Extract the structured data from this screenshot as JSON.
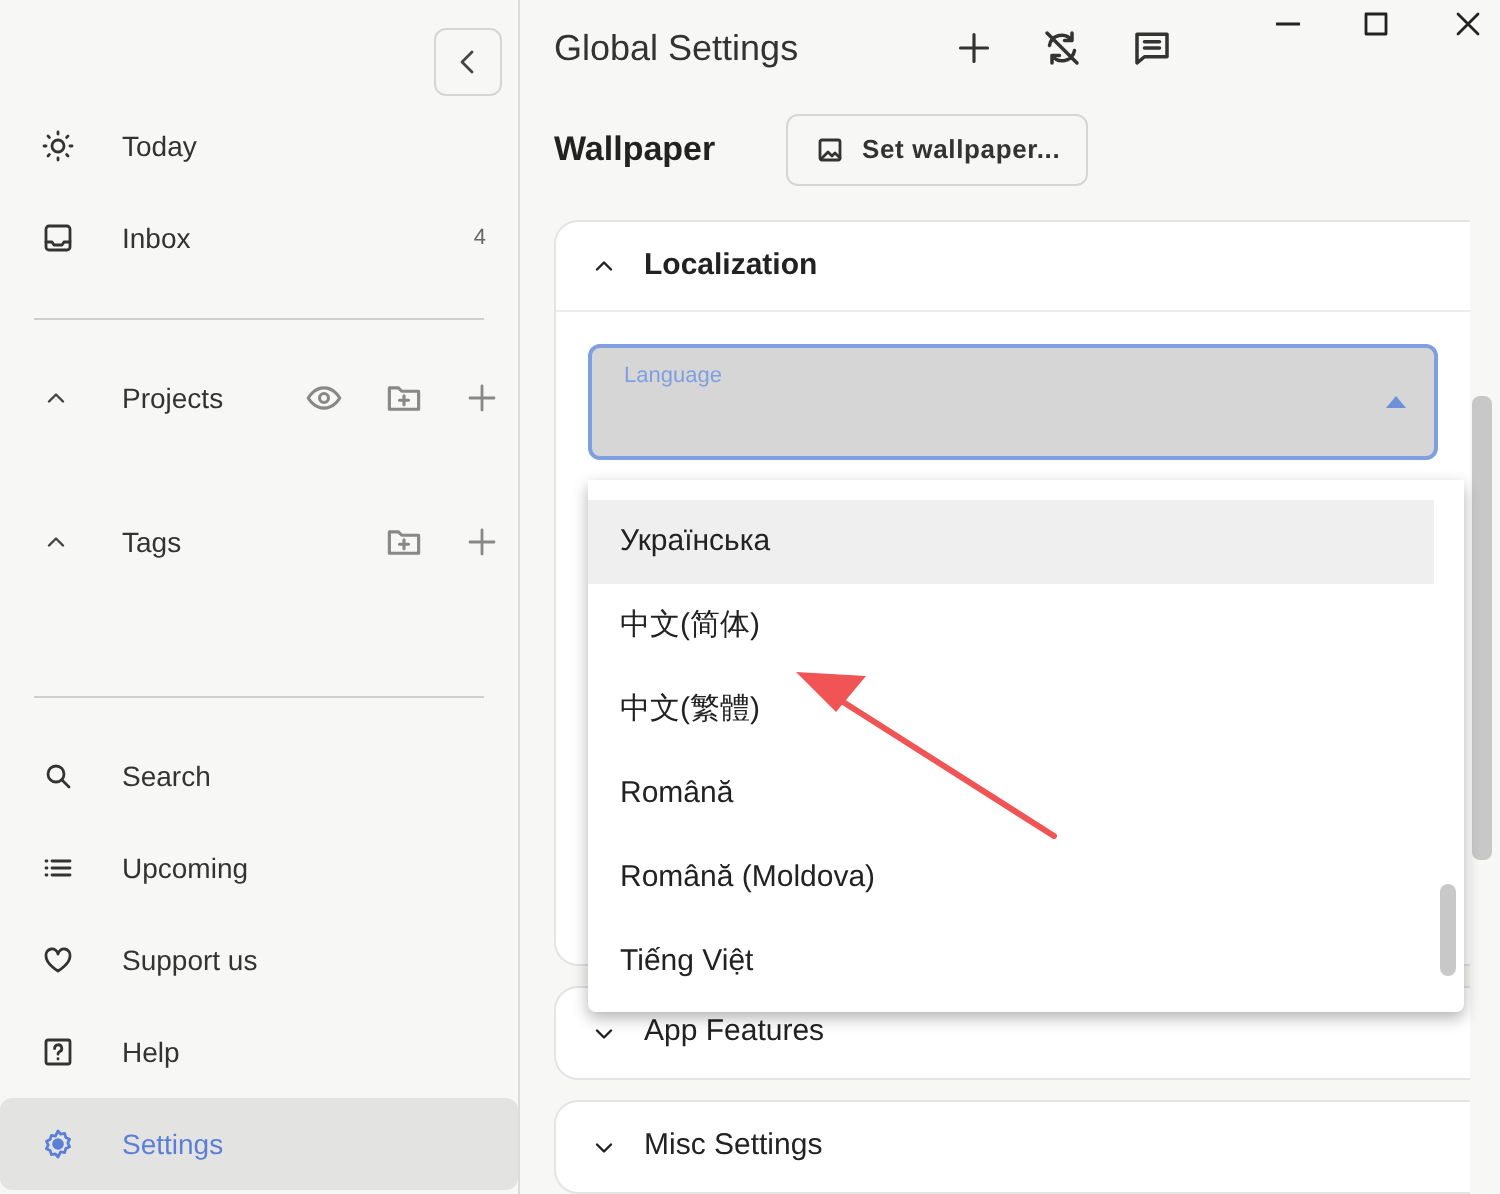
{
  "sidebar": {
    "top_items": [
      {
        "label": "Today",
        "selected": false
      },
      {
        "label": "Inbox",
        "count": "4",
        "selected": false
      }
    ],
    "sections": [
      {
        "label": "Projects",
        "expanded": true
      },
      {
        "label": "Tags",
        "expanded": true
      }
    ],
    "bottom_items": [
      {
        "label": "Search",
        "selected": false
      },
      {
        "label": "Upcoming",
        "selected": false
      },
      {
        "label": "Support us",
        "selected": false
      },
      {
        "label": "Help",
        "selected": false
      },
      {
        "label": "Settings",
        "selected": true
      }
    ]
  },
  "header": {
    "title": "Global Settings"
  },
  "wallpaper": {
    "label": "Wallpaper",
    "button": "Set wallpaper..."
  },
  "panels": [
    {
      "title": "Localization",
      "expanded": true
    },
    {
      "title": "App Features",
      "expanded": false
    },
    {
      "title": "Misc Settings",
      "expanded": false
    }
  ],
  "language_select": {
    "label": "Language",
    "open": true,
    "options": [
      {
        "label": "Українська",
        "highlighted": true
      },
      {
        "label": "中文(简体)",
        "highlighted": false
      },
      {
        "label": "中文(繁體)",
        "highlighted": false
      },
      {
        "label": "Română",
        "highlighted": false
      },
      {
        "label": "Română (Moldova)",
        "highlighted": false
      },
      {
        "label": "Tiếng Việt",
        "highlighted": false
      }
    ]
  }
}
